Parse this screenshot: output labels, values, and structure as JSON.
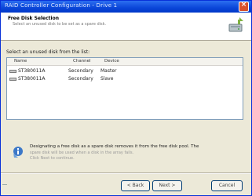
{
  "window": {
    "title": "RAID Controller Configuration - Drive 1"
  },
  "header": {
    "title": "Free Disk Selection",
    "subtitle": "Select an unused disk to be set as a spare disk.",
    "icon": "disk-config-icon"
  },
  "list": {
    "label": "Select an unused disk from the list:",
    "columns": [
      "Name",
      "Channel",
      "Device"
    ],
    "rows": [
      {
        "name": "ST380011A",
        "channel": "Secondary",
        "device": "Master"
      },
      {
        "name": "ST380011A",
        "channel": "Secondary",
        "device": "Slave"
      }
    ]
  },
  "info": {
    "icon": "info-icon",
    "line1": "Designating a free disk as a spare disk removes it from the free disk pool. The",
    "line2": "spare disk will be used when a disk in the array fails.",
    "line3": "Click Next to continue."
  },
  "buttons": {
    "back": "< Back",
    "next": "Next >",
    "cancel": "Cancel"
  },
  "colors": {
    "title_bar": "#0a46d8",
    "window_bg": "#ece9d8",
    "close_button": "#d9502b"
  }
}
